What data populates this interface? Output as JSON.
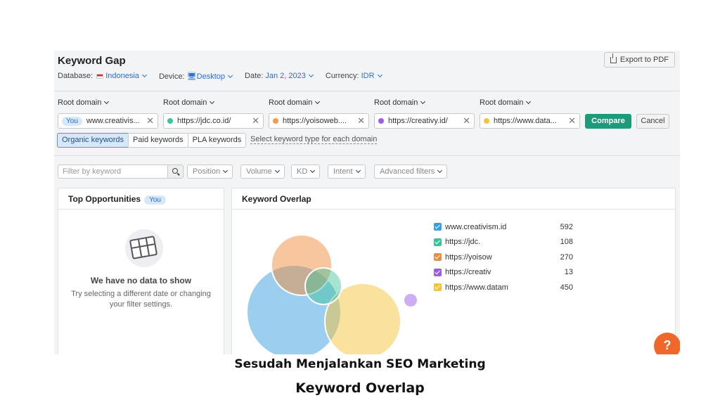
{
  "header": {
    "title": "Keyword Gap",
    "export_label": "Export to PDF",
    "database_label": "Database:",
    "database_value": "Indonesia",
    "device_label": "Device:",
    "device_value": "Desktop",
    "date_label": "Date:",
    "date_value": "Jan 2, 2023",
    "currency_label": "Currency:",
    "currency_value": "IDR"
  },
  "domains": {
    "root_label": "Root domain",
    "you_label": "You",
    "items": [
      {
        "value": "www.creativis...",
        "color": "#2e98d8",
        "you": true
      },
      {
        "value": "https://jdc.co.id/",
        "color": "#39c49a"
      },
      {
        "value": "https://yoisoweb....",
        "color": "#f39a4c"
      },
      {
        "value": "https://creativy.id/",
        "color": "#9b5ce8"
      },
      {
        "value": "https://www.data...",
        "color": "#f5c33b"
      }
    ],
    "compare_label": "Compare",
    "cancel_label": "Cancel"
  },
  "keyword_types": {
    "tabs": [
      "Organic keywords",
      "Paid keywords",
      "PLA keywords"
    ],
    "active": 0,
    "select_link": "Select keyword type for each domain"
  },
  "filters": {
    "search_placeholder": "Filter by keyword",
    "dropdowns": [
      "Position",
      "Volume",
      "KD",
      "Intent",
      "Advanced filters"
    ]
  },
  "top_opportunities": {
    "title": "Top Opportunities",
    "badge": "You",
    "empty_title": "We have no data to show",
    "empty_subtitle_line1": "Try selecting a different date or changing",
    "empty_subtitle_line2": "your filter settings."
  },
  "keyword_overlap": {
    "title": "Keyword Overlap",
    "legend": [
      {
        "name": "www.creativism.id",
        "count": "592",
        "color": "#3a9ee0"
      },
      {
        "name": "https://jdc.",
        "count": "108",
        "color": "#3cc29a"
      },
      {
        "name": "https://yoisow",
        "count": "270",
        "color": "#f08c3e"
      },
      {
        "name": "https://creativ",
        "count": "13",
        "color": "#9b5ce8"
      },
      {
        "name": "https://www.datam",
        "count": "450",
        "color": "#f5c33b"
      }
    ]
  },
  "help_label": "?",
  "caption": {
    "line1": "Sesudah Menjalankan SEO Marketing",
    "line2": "Keyword Overlap"
  }
}
